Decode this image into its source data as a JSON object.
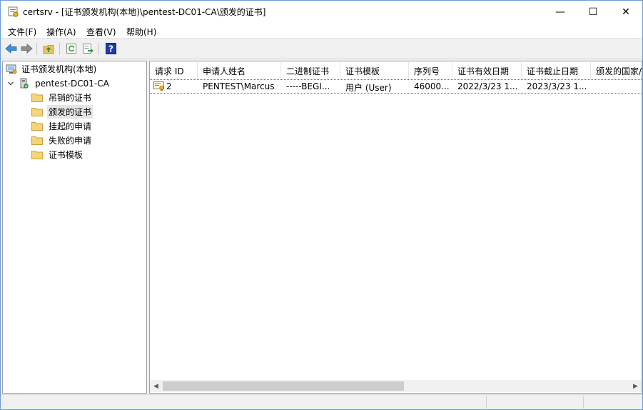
{
  "window": {
    "title": "certsrv - [证书颁发机构(本地)\\pentest-DC01-CA\\颁发的证书]",
    "minimize_glyph": "—",
    "maximize_glyph": "☐",
    "close_glyph": "✕"
  },
  "menu": {
    "items": [
      {
        "label": "文件(F)"
      },
      {
        "label": "操作(A)"
      },
      {
        "label": "查看(V)"
      },
      {
        "label": "帮助(H)"
      }
    ]
  },
  "toolbar": {
    "icons": [
      "back-arrow-icon",
      "forward-arrow-icon",
      "up-folder-icon",
      "refresh-icon",
      "export-list-icon",
      "help-icon"
    ],
    "help_glyph": "?"
  },
  "tree": {
    "root": {
      "label": "证书颁发机构(本地)",
      "icon": "ca-computer-icon"
    },
    "ca": {
      "label": "pentest-DC01-CA",
      "icon": "ca-server-icon",
      "expander": "expanded"
    },
    "folders": [
      {
        "label": "吊销的证书"
      },
      {
        "label": "颁发的证书"
      },
      {
        "label": "挂起的申请"
      },
      {
        "label": "失败的申请"
      },
      {
        "label": "证书模板"
      }
    ],
    "selected": "颁发的证书"
  },
  "list": {
    "columns": [
      {
        "label": "请求 ID"
      },
      {
        "label": "申请人姓名"
      },
      {
        "label": "二进制证书"
      },
      {
        "label": "证书模板"
      },
      {
        "label": "序列号"
      },
      {
        "label": "证书有效日期"
      },
      {
        "label": "证书截止日期"
      },
      {
        "label": "颁发的国家/"
      }
    ],
    "rows": [
      {
        "icon": "certificate-icon",
        "cells": [
          "2",
          "PENTEST\\Marcus",
          "-----BEGI...",
          "用户 (User)",
          "46000...",
          "2022/3/23 1...",
          "2023/3/23 1..."
        ]
      }
    ]
  },
  "scrollbar": {
    "left_arrow": "◀",
    "right_arrow": "▶"
  },
  "colors": {
    "window_border": "#6b9bd8",
    "selection": "#e5e5e5",
    "folder": "#e8c25a"
  }
}
